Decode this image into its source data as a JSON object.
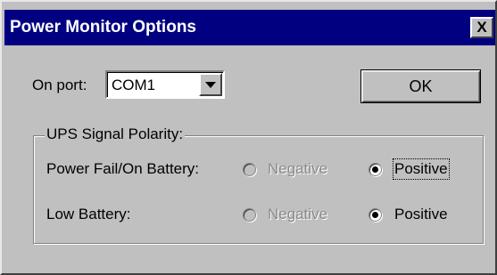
{
  "window": {
    "title": "Power Monitor Options",
    "close_label": "X"
  },
  "port": {
    "label": "On port:",
    "value": "COM1"
  },
  "ok_button": "OK",
  "polarity": {
    "group_title": "UPS Signal Polarity:",
    "rows": [
      {
        "label": "Power Fail/On Battery:",
        "negative": "Negative",
        "positive": "Positive",
        "selected": "Positive",
        "negative_enabled": false
      },
      {
        "label": "Low Battery:",
        "negative": "Negative",
        "positive": "Positive",
        "selected": "Positive",
        "negative_enabled": false
      }
    ]
  }
}
